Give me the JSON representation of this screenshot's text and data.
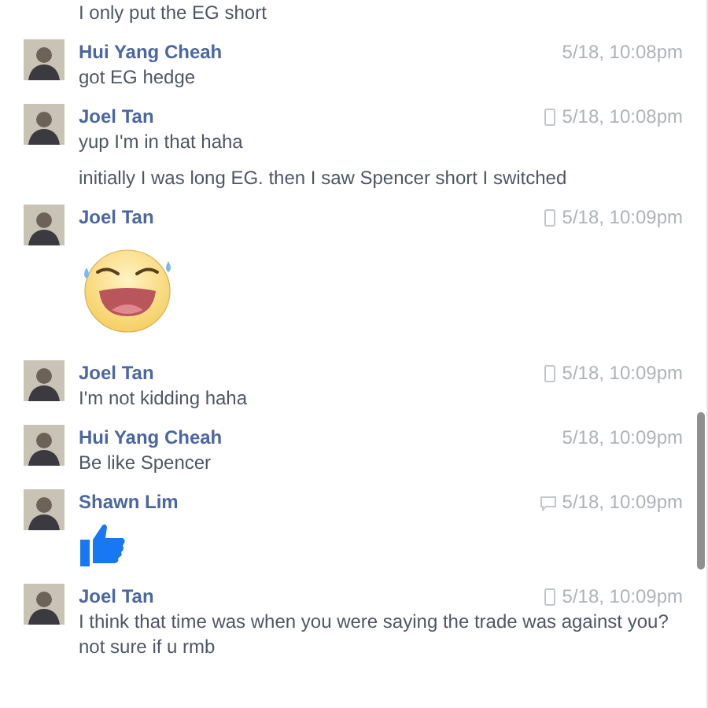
{
  "messages": [
    {
      "kind": "text",
      "lines": [
        "I only put the EG short"
      ]
    },
    {
      "kind": "text",
      "sender": "Hui Yang Cheah",
      "time": "5/18, 10:08pm",
      "lines": [
        "got EG hedge"
      ]
    },
    {
      "kind": "text",
      "sender": "Joel Tan",
      "time": "5/18, 10:08pm",
      "sent_from": {
        "kind": "mobile"
      },
      "lines": [
        "yup I'm in that haha",
        "initially I was long EG. then I saw Spencer short I switched"
      ]
    },
    {
      "kind": "sticker",
      "sender": "Joel Tan",
      "time": "5/18, 10:09pm",
      "sent_from": {
        "kind": "mobile"
      }
    },
    {
      "kind": "text",
      "sender": "Joel Tan",
      "time": "5/18, 10:09pm",
      "sent_from": {
        "kind": "mobile"
      },
      "lines": [
        "I'm not kidding haha"
      ]
    },
    {
      "kind": "text",
      "sender": "Hui Yang Cheah",
      "time": "5/18, 10:09pm",
      "lines": [
        "Be like Spencer"
      ]
    },
    {
      "kind": "like",
      "sender": "Shawn Lim",
      "time": "5/18, 10:09pm",
      "sent_from": {
        "kind": "web"
      }
    },
    {
      "kind": "text",
      "sender": "Joel Tan",
      "time": "5/18, 10:09pm",
      "sent_from": {
        "kind": "mobile"
      },
      "lines": [
        "I think that time was when you were saying the trade was against you?\nnot sure if u rmb"
      ]
    }
  ]
}
